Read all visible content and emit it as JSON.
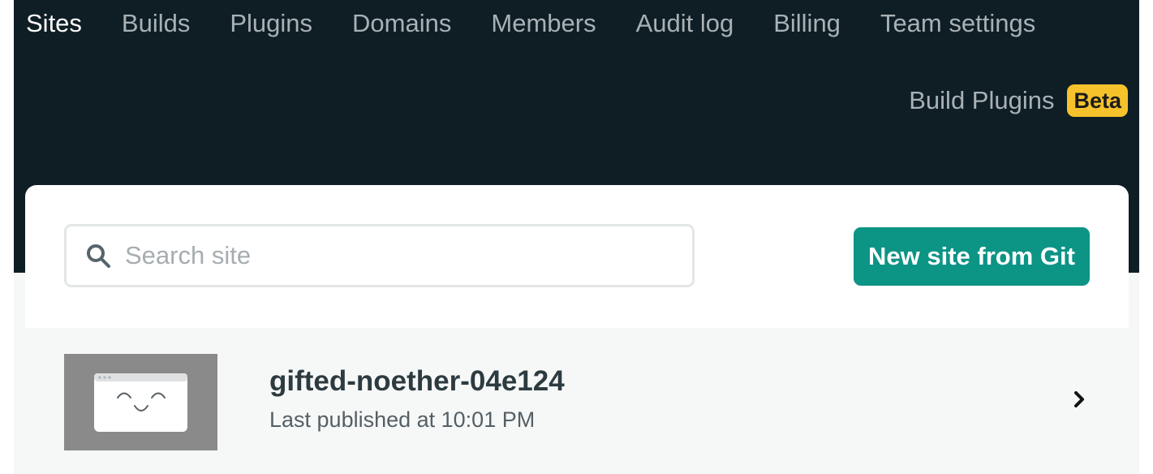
{
  "top_nav": {
    "items": [
      {
        "label": "Sites",
        "active": true
      },
      {
        "label": "Builds",
        "active": false
      },
      {
        "label": "Plugins",
        "active": false
      },
      {
        "label": "Domains",
        "active": false
      },
      {
        "label": "Members",
        "active": false
      },
      {
        "label": "Audit log",
        "active": false
      },
      {
        "label": "Billing",
        "active": false
      },
      {
        "label": "Team settings",
        "active": false
      }
    ]
  },
  "sub_nav": {
    "label": "Build Plugins",
    "badge": "Beta"
  },
  "toolbar": {
    "search_placeholder": "Search site",
    "search_value": "",
    "search_icon": "search-icon",
    "new_site_label": "New site from Git"
  },
  "sites": [
    {
      "name": "gifted-noether-04e124",
      "meta": "Last published at 10:01 PM",
      "thumbnail_icon": "smiling-browser-window-icon",
      "action_icon": "chevron-right-icon"
    }
  ],
  "colors": {
    "header_background": "#0f1e25",
    "active_nav": "#ffffff",
    "inactive_nav": "#a8b1b4",
    "badge_background": "#f6c22b",
    "primary_button": "#0c9485",
    "row_background": "#f6f8f8",
    "site_text": "#2d3b41"
  }
}
